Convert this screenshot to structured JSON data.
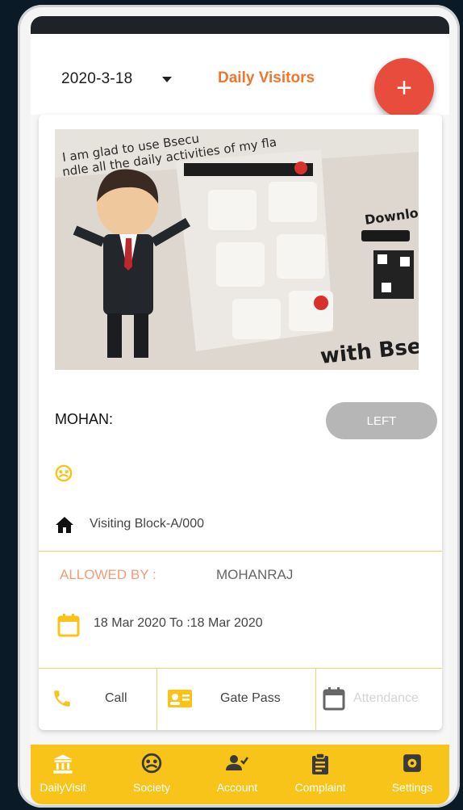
{
  "header": {
    "date": "2020-3-18",
    "title": "Daily Visitors",
    "add_symbol": "+"
  },
  "visitor": {
    "name": "MOHAN:",
    "status_button": "LEFT",
    "visiting": "Visiting Block-A/000",
    "allowed_by_label": "ALLOWED BY :",
    "allowed_by_value": "MOHANRAJ",
    "date_range": "18 Mar 2020 To :18 Mar 2020"
  },
  "actions": [
    {
      "label": "Call",
      "icon": "phone-icon"
    },
    {
      "label": "Gate Pass",
      "icon": "id-card-icon"
    },
    {
      "label": "Attendance",
      "icon": "calendar-icon"
    }
  ],
  "nav": [
    {
      "label": "DailyVisit",
      "icon": "bank-icon"
    },
    {
      "label": "Society",
      "icon": "society-icon"
    },
    {
      "label": "Account",
      "icon": "user-check-icon"
    },
    {
      "label": "Complaint",
      "icon": "clipboard-icon"
    },
    {
      "label": "Settings",
      "icon": "settings-icon"
    }
  ],
  "colors": {
    "accent": "#f0752e",
    "fab": "#e84c3d",
    "nav_bg": "#f9c41a",
    "icon_yellow": "#f9c41a",
    "disabled_button": "#b6b6b6"
  }
}
